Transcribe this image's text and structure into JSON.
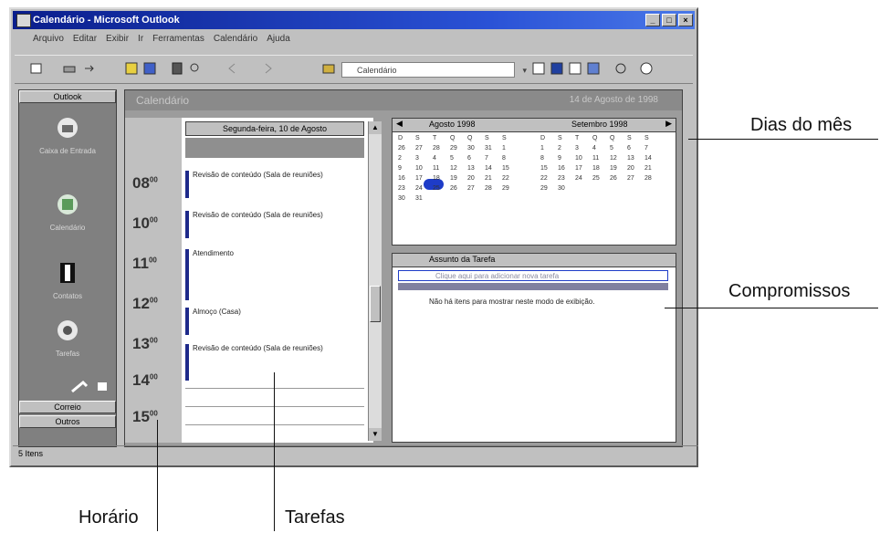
{
  "window": {
    "title": "Calendário - Microsoft Outlook",
    "controls": {
      "minimize": "_",
      "maximize": "□",
      "close": "×"
    }
  },
  "menu": [
    "Arquivo",
    "Editar",
    "Exibir",
    "Ir",
    "Ferramentas",
    "Calendário",
    "Ajuda"
  ],
  "toolbar": {
    "view_dropdown": "Calendário"
  },
  "outlook_bar": {
    "top_group": "Outlook",
    "items": [
      "Caixa de Entrada",
      "Calendário",
      "Contatos",
      "Tarefas"
    ],
    "bottom_groups": [
      "Correio",
      "Outros"
    ]
  },
  "content": {
    "folder_title": "Calendário",
    "date_header": "14 de Agosto de 1998",
    "day_header": "Segunda-feira, 10 de Agosto",
    "hours": [
      "08",
      "10",
      "11",
      "12",
      "13",
      "14",
      "15"
    ],
    "hour_suffix": "00",
    "appointments": [
      "Revisão de conteúdo (Sala de reuniões)",
      "Revisão de conteúdo (Sala de reuniões)",
      "Atendimento",
      "Almoço (Casa)",
      "Revisão de conteúdo (Sala de reuniões)"
    ]
  },
  "calendar": {
    "months": [
      "Agosto 1998",
      "Setembro 1998"
    ],
    "weekdays": [
      "D",
      "S",
      "T",
      "Q",
      "Q",
      "S",
      "S"
    ],
    "august_days": [
      "26",
      "27",
      "28",
      "29",
      "30",
      "31",
      "1",
      "2",
      "3",
      "4",
      "5",
      "6",
      "7",
      "8",
      "9",
      "10",
      "11",
      "12",
      "13",
      "14",
      "15",
      "16",
      "17",
      "18",
      "19",
      "20",
      "21",
      "22",
      "23",
      "24",
      "25",
      "26",
      "27",
      "28",
      "29",
      "30",
      "31"
    ],
    "september_days": [
      "1",
      "2",
      "3",
      "4",
      "5",
      "6",
      "7",
      "8",
      "9",
      "10",
      "11",
      "12",
      "13",
      "14",
      "15",
      "16",
      "17",
      "18",
      "19",
      "20",
      "21",
      "22",
      "23",
      "24",
      "25",
      "26",
      "27",
      "28",
      "29",
      "30"
    ]
  },
  "tasks": {
    "header": "Assunto da Tarefa",
    "new_task_placeholder": "Clique aqui para adicionar nova tarefa",
    "items": [
      "Não há itens para mostrar neste modo de exibição."
    ]
  },
  "statusbar": {
    "text": "5 Itens"
  },
  "callouts": {
    "dias": "Dias do mês",
    "compromissos": "Compromissos",
    "horario": "Horário",
    "tarefas": "Tarefas"
  }
}
